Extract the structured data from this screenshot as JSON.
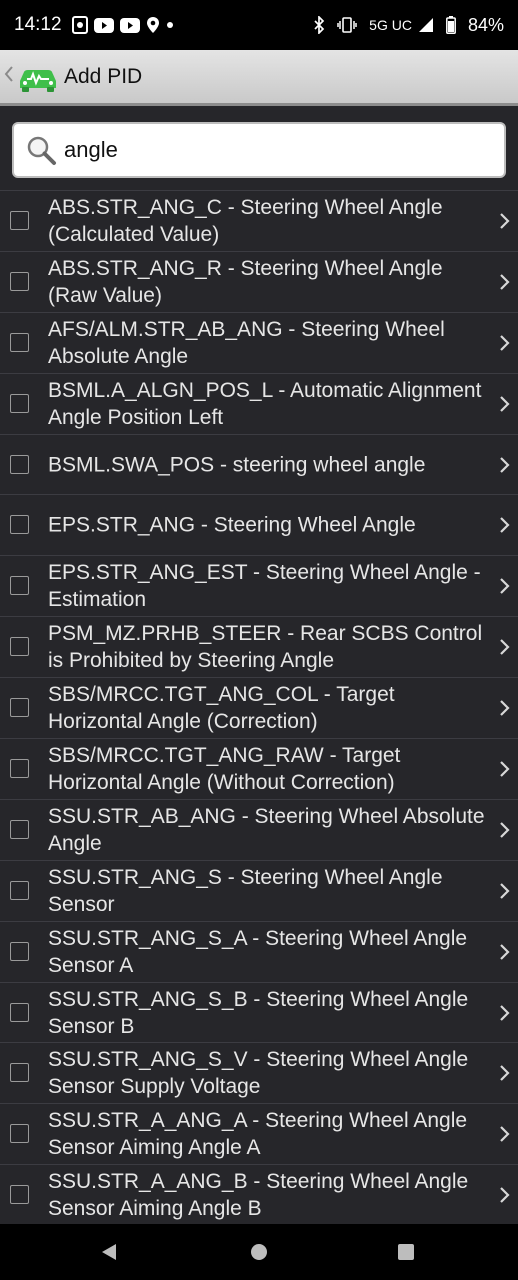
{
  "status_bar": {
    "time": "14:12",
    "network": "5G UC",
    "battery": "84%"
  },
  "app_bar": {
    "title": "Add PID"
  },
  "search": {
    "value": "angle"
  },
  "items": [
    {
      "label": "ABS.STR_ANG_C - Steering Wheel Angle (Calculated Value)"
    },
    {
      "label": "ABS.STR_ANG_R - Steering Wheel Angle (Raw Value)"
    },
    {
      "label": "AFS/ALM.STR_AB_ANG - Steering Wheel Absolute Angle"
    },
    {
      "label": "BSML.A_ALGN_POS_L - Automatic Alignment Angle Position Left"
    },
    {
      "label": "BSML.SWA_POS - steering wheel angle"
    },
    {
      "label": "EPS.STR_ANG - Steering Wheel Angle"
    },
    {
      "label": "EPS.STR_ANG_EST - Steering Wheel Angle - Estimation"
    },
    {
      "label": "PSM_MZ.PRHB_STEER - Rear SCBS Control is Prohibited by Steering Angle"
    },
    {
      "label": "SBS/MRCC.TGT_ANG_COL - Target Horizontal Angle (Correction)"
    },
    {
      "label": "SBS/MRCC.TGT_ANG_RAW - Target Horizontal Angle (Without Correction)"
    },
    {
      "label": "SSU.STR_AB_ANG - Steering Wheel Absolute Angle"
    },
    {
      "label": "SSU.STR_ANG_S - Steering Wheel Angle Sensor"
    },
    {
      "label": "SSU.STR_ANG_S_A - Steering Wheel Angle Sensor A"
    },
    {
      "label": "SSU.STR_ANG_S_B - Steering Wheel Angle Sensor B"
    },
    {
      "label": "SSU.STR_ANG_S_V - Steering Wheel Angle Sensor Supply Voltage"
    },
    {
      "label": "SSU.STR_A_ANG_A - Steering Wheel Angle Sensor Aiming Angle A"
    },
    {
      "label": "SSU.STR_A_ANG_B - Steering Wheel Angle Sensor Aiming Angle B"
    }
  ],
  "colors": {
    "background": "#26262a",
    "logo_green": "#3fbf4a"
  },
  "icons": {
    "search": "search-icon",
    "back": "back-chevron-icon",
    "row_chevron": "chevron-right-icon"
  }
}
